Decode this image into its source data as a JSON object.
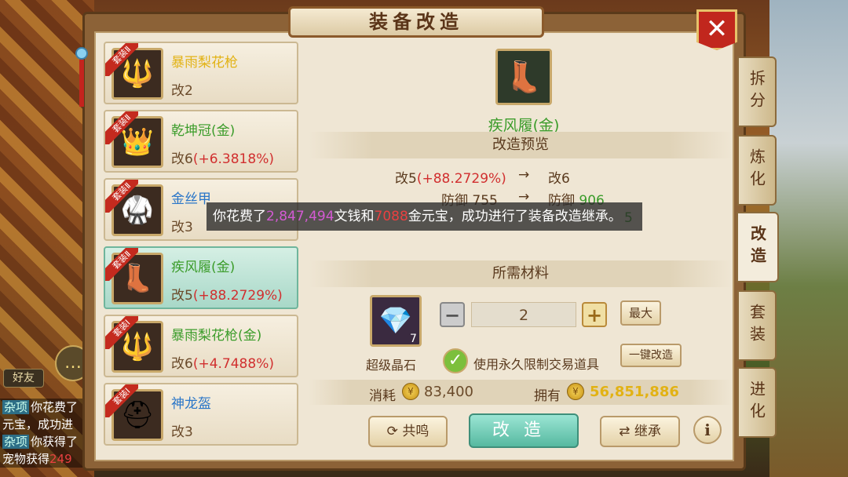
{
  "window": {
    "title": "装备改造",
    "close_label": "✕"
  },
  "side_tabs": [
    "拆分",
    "炼化",
    "改造",
    "套装",
    "进化"
  ],
  "active_tab": "改造",
  "equipment_list": [
    {
      "badge": "套装Ⅱ",
      "name": "暴雨梨花枪",
      "level": "改2",
      "bonus": "",
      "name_color": "yellow",
      "icon": "spear-icon"
    },
    {
      "badge": "套装Ⅱ",
      "name": "乾坤冠(金)",
      "level": "改6",
      "bonus": "(+6.3818%)",
      "name_color": "green",
      "icon": "crown-icon"
    },
    {
      "badge": "套装Ⅱ",
      "name": "金丝甲",
      "level": "改3",
      "bonus": "",
      "name_color": "blue",
      "icon": "armor-icon"
    },
    {
      "badge": "套装Ⅱ",
      "name": "疾风履(金)",
      "level": "改5",
      "bonus": "(+88.2729%)",
      "name_color": "green",
      "icon": "boots-icon",
      "selected": true
    },
    {
      "badge": "套装Ⅰ",
      "name": "暴雨梨花枪(金)",
      "level": "改6",
      "bonus": "(+4.7488%)",
      "name_color": "green",
      "icon": "spear-icon"
    },
    {
      "badge": "套装Ⅰ",
      "name": "神龙盔",
      "level": "改3",
      "bonus": "",
      "name_color": "blue",
      "icon": "helmet-icon"
    }
  ],
  "selected_equipment": {
    "name": "疾风履(金)",
    "icon": "boots-icon"
  },
  "preview": {
    "header": "改造预览",
    "level_from": "改5",
    "level_from_bonus": "(+88.2729%)",
    "level_to": "改6",
    "arrow": "→",
    "stat_label": "防御",
    "stat_from": "755",
    "stat_to": "906",
    "hidden_row_tail": "5"
  },
  "toast": {
    "prefix": "你花费了",
    "money": "2,847,494",
    "mid1": "文钱和",
    "gold": "7088",
    "suffix": "金元宝，成功进行了装备改造继承。"
  },
  "materials": {
    "header": "所需材料",
    "item_name": "超级晶石",
    "item_count": "7",
    "quantity": "2",
    "minus_label": "−",
    "plus_label": "+",
    "max_label": "最大",
    "use_bound_label": "使用永久限制交易道具",
    "use_bound_checked": true,
    "one_click_label": "一键改造"
  },
  "cost": {
    "consume_label": "消耗",
    "consume_value": "83,400",
    "own_label": "拥有",
    "own_value": "56,851,886"
  },
  "actions": {
    "resonance": "共鸣",
    "refine": "改造",
    "inherit": "继承",
    "info": "i"
  },
  "chat": {
    "friend_label": "好友",
    "lines": [
      {
        "tag": "杂项",
        "text": "你花费了"
      },
      {
        "tag": "",
        "text": "元宝，成功进"
      },
      {
        "tag": "杂项",
        "text": "你获得了"
      },
      {
        "tag": "",
        "text": "宠物获得",
        "red": "249"
      }
    ]
  },
  "colors": {
    "green": "#3b9c2a",
    "yellow": "#e2b214",
    "blue": "#2a76c8",
    "red": "#d12f2f",
    "accent_teal": "#56b9a0"
  }
}
